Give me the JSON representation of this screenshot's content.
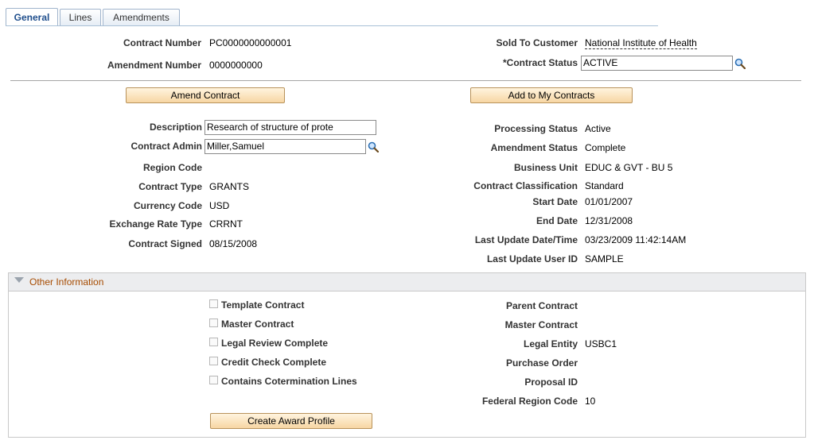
{
  "tabs": [
    {
      "label": "General"
    },
    {
      "label": "Lines"
    },
    {
      "label": "Amendments"
    }
  ],
  "header": {
    "contract_number_label": "Contract Number",
    "contract_number_value": "PC0000000000001",
    "amendment_number_label": "Amendment Number",
    "amendment_number_value": "0000000000",
    "sold_to_label": "Sold To Customer",
    "sold_to_value": "National Institute of Health",
    "contract_status_label": "*Contract Status",
    "contract_status_value": "ACTIVE"
  },
  "buttons": {
    "amend_contract": "Amend Contract",
    "add_to_my_contracts": "Add to My Contracts",
    "create_award_profile": "Create Award Profile"
  },
  "left_fields": {
    "description_label": "Description",
    "description_value": "Research of structure of prote",
    "contract_admin_label": "Contract Admin",
    "contract_admin_value": "Miller,Samuel",
    "region_code_label": "Region Code",
    "contract_type_label": "Contract Type",
    "contract_type_value": "GRANTS",
    "currency_code_label": "Currency Code",
    "currency_code_value": "USD",
    "exchange_rate_type_label": "Exchange Rate Type",
    "exchange_rate_type_value": "CRRNT",
    "contract_signed_label": "Contract Signed",
    "contract_signed_value": "08/15/2008"
  },
  "right_fields": {
    "processing_status_label": "Processing Status",
    "processing_status_value": "Active",
    "amendment_status_label": "Amendment Status",
    "amendment_status_value": "Complete",
    "business_unit_label": "Business Unit",
    "business_unit_value": "EDUC & GVT - BU 5",
    "contract_classification_label": "Contract Classification",
    "contract_classification_value": "Standard",
    "start_date_label": "Start Date",
    "start_date_value": "01/01/2007",
    "end_date_label": "End Date",
    "end_date_value": "12/31/2008",
    "last_update_dt_label": "Last Update Date/Time",
    "last_update_dt_value": "03/23/2009 11:42:14AM",
    "last_update_user_label": "Last Update User ID",
    "last_update_user_value": "SAMPLE"
  },
  "other_info": {
    "title": "Other Information",
    "checkboxes": [
      {
        "label": "Template Contract",
        "checked": false
      },
      {
        "label": "Master Contract",
        "checked": false
      },
      {
        "label": "Legal Review Complete",
        "checked": false
      },
      {
        "label": "Credit Check Complete",
        "checked": false
      },
      {
        "label": "Contains Cotermination Lines",
        "checked": false
      }
    ],
    "parent_contract_label": "Parent Contract",
    "master_contract_label": "Master Contract",
    "legal_entity_label": "Legal Entity",
    "legal_entity_value": "USBC1",
    "purchase_order_label": "Purchase Order",
    "proposal_id_label": "Proposal ID",
    "federal_region_code_label": "Federal Region Code",
    "federal_region_code_value": "10"
  },
  "icons": {
    "lookup": "magnifier-icon",
    "collapse": "triangle-down-icon"
  },
  "colors": {
    "button_bg": "#f7d6a3",
    "section_title": "#a64b00",
    "tab_active_text": "#1f4e8c"
  }
}
